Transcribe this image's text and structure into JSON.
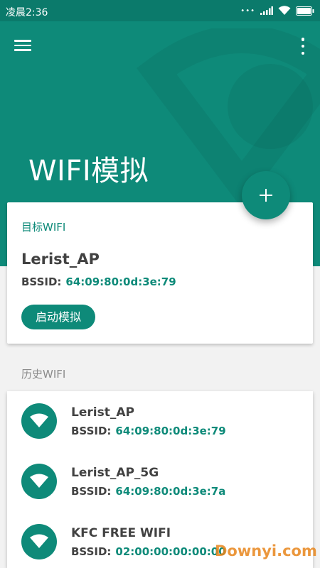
{
  "status_bar": {
    "time": "凌晨2:36",
    "icons": [
      "dots-icon",
      "signal-icon",
      "wifi-icon",
      "battery-icon"
    ]
  },
  "app_bar": {
    "title": "WIFI模拟",
    "menu_icon": "hamburger-menu-icon",
    "more_icon": "more-vert-icon",
    "color": "#0e8a79"
  },
  "fab": {
    "icon": "plus-icon"
  },
  "target_card": {
    "label": "目标WIFI",
    "ssid": "Lerist_AP",
    "bssid_label": "BSSID:",
    "bssid_value": "64:09:80:0d:3e:79",
    "start_button": "启动模拟"
  },
  "history": {
    "label": "历史WIFI",
    "items": [
      {
        "ssid": "Lerist_AP",
        "bssid_label": "BSSID:",
        "bssid_value": "64:09:80:0d:3e:79"
      },
      {
        "ssid": "Lerist_AP_5G",
        "bssid_label": "BSSID:",
        "bssid_value": "64:09:80:0d:3e:7a"
      },
      {
        "ssid": "KFC FREE WIFI",
        "bssid_label": "BSSID:",
        "bssid_value": "02:00:00:00:00:00"
      }
    ]
  },
  "watermark": "Downyi.com",
  "colors": {
    "accent": "#0e8a79",
    "status_bar": "#0b7a6b",
    "background": "#f2f2f2"
  }
}
